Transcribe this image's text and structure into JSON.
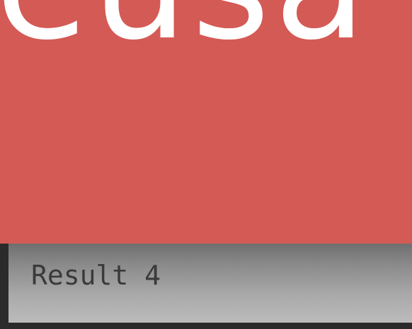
{
  "hero": {
    "visible_text": "eusa",
    "background_color": "#d45a55",
    "text_color": "#ffffff"
  },
  "result": {
    "label": "Result 4"
  }
}
